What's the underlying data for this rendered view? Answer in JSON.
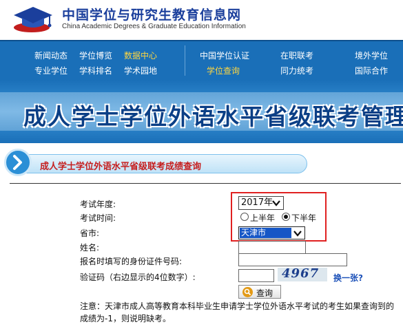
{
  "site": {
    "title": "中国学位与研究生教育信息网",
    "subtitle": "China Academic Degrees & Graduate Education Information"
  },
  "nav": {
    "items": [
      {
        "label": "新闻动态"
      },
      {
        "label": "学位博览"
      },
      {
        "label": "数据中心",
        "highlight": true
      },
      {
        "label": "中国学位认证"
      },
      {
        "label": "在职联考"
      },
      {
        "label": "境外学位"
      },
      {
        "label": "专业学位"
      },
      {
        "label": "学科排名"
      },
      {
        "label": "学术园地"
      },
      {
        "label": "学位查询",
        "highlight": true
      },
      {
        "label": "同力统考"
      },
      {
        "label": "国际合作"
      }
    ],
    "highlight_color": "#ffd640",
    "bar_color": "#1a6fb8"
  },
  "banner": {
    "title": "成人学士学位外语水平省级联考管理信息"
  },
  "section": {
    "title": "成人学士学位外语水平省级联考成绩查询"
  },
  "form": {
    "year_label": "考试年度:",
    "year_value": "2017年",
    "time_label": "考试时间:",
    "time_options": [
      {
        "label": "上半年",
        "selected": false
      },
      {
        "label": "下半年",
        "selected": true
      }
    ],
    "province_label": "省市:",
    "province_value": "天津市",
    "name_label": "姓名:",
    "name_value": "",
    "id_label": "报名时填写的身份证件号码:",
    "id_value": "",
    "captcha_label": "验证码（右边显示的4位数字）:",
    "captcha_value": "",
    "captcha_image_text": "4967",
    "change_link": "换一张?",
    "query_button": "查询"
  },
  "note": "注意：天津市成人高等教育本科毕业生申请学士学位外语水平考试的考生如果查询到的成绩为-1，则说明缺考。",
  "colors": {
    "highlight_box": "#e02020",
    "section_title": "#c61f1f",
    "selected_province_bg": "#1556c6"
  }
}
